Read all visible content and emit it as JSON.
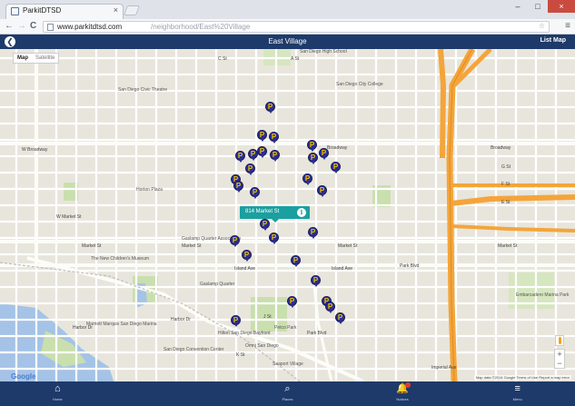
{
  "browser": {
    "tab_title": "ParkitDTSD",
    "tab_close": "×",
    "url_host": "www.parkitdtsd.com",
    "url_path": "/neighborhood/East%20Village",
    "back_glyph": "←",
    "forward_glyph": "→",
    "reload_glyph": "C",
    "omni_icons": "☆",
    "menu_glyph": "≡",
    "window_controls": [
      "–",
      "□",
      "×"
    ]
  },
  "header": {
    "title": "East Village",
    "back_glyph": "❮",
    "list_label": "List Map"
  },
  "map": {
    "type_options": [
      "Map",
      "Satellite"
    ],
    "callout_text": "814 Market St",
    "info_glyph": "i",
    "pin_glyph": "P",
    "google_text": "Google",
    "attribution": "Map data ©2014 Google   Terms of Use   Report a map error",
    "zoom_in": "+",
    "zoom_out": "−",
    "labels": [
      {
        "text": "Broadway",
        "kind": "road"
      },
      {
        "text": "Broadway",
        "kind": "road"
      },
      {
        "text": "Market St",
        "kind": "road"
      },
      {
        "text": "Market St",
        "kind": "road"
      },
      {
        "text": "Market St",
        "kind": "road"
      },
      {
        "text": "Market St",
        "kind": "road"
      },
      {
        "text": "Island Ave",
        "kind": "road"
      },
      {
        "text": "Island Ave",
        "kind": "road"
      },
      {
        "text": "J St",
        "kind": "road"
      },
      {
        "text": "K St",
        "kind": "road"
      },
      {
        "text": "G St",
        "kind": "road"
      },
      {
        "text": "F St",
        "kind": "road"
      },
      {
        "text": "E St",
        "kind": "road"
      },
      {
        "text": "C St",
        "kind": "road"
      },
      {
        "text": "A St",
        "kind": "road"
      },
      {
        "text": "W Broadway",
        "kind": "road"
      },
      {
        "text": "W Market St",
        "kind": "road"
      },
      {
        "text": "Park Blvd",
        "kind": "road"
      },
      {
        "text": "Harbor Dr",
        "kind": "road"
      },
      {
        "text": "Imperial Ave",
        "kind": "road"
      },
      {
        "text": "San Diego City College",
        "kind": "poi"
      },
      {
        "text": "San Diego High School",
        "kind": "poi"
      },
      {
        "text": "San Diego Civic Theatre",
        "kind": "poi"
      },
      {
        "text": "Horton Plaza",
        "kind": "poi"
      },
      {
        "text": "Petco Park",
        "kind": "poi"
      },
      {
        "text": "San Diego Convention Center",
        "kind": "poi"
      },
      {
        "text": "Marriott Marquis San Diego Marina",
        "kind": "poi"
      },
      {
        "text": "Hilton San Diego Bayfront",
        "kind": "poi"
      },
      {
        "text": "Omni San Diego",
        "kind": "poi"
      },
      {
        "text": "Embarcadero Marina Park",
        "kind": "poi"
      },
      {
        "text": "The New Children's Museum",
        "kind": "poi"
      },
      {
        "text": "Gaslamp Quarter Association",
        "kind": "poi"
      },
      {
        "text": "Seaport Village",
        "kind": "poi"
      },
      {
        "text": "Park Blvd",
        "kind": "road"
      },
      {
        "text": "Harbor Dr",
        "kind": "road"
      },
      {
        "text": "Gaslamp Quarter",
        "kind": "poi"
      }
    ],
    "pin_count": 29
  },
  "bottom_nav": [
    {
      "label": "Home",
      "icon": "⌂",
      "name": "home"
    },
    {
      "label": "",
      "icon": "",
      "name": "blank"
    },
    {
      "label": "Places",
      "icon": "⌕",
      "name": "search"
    },
    {
      "label": "Notices",
      "icon": "🔔",
      "name": "notices"
    },
    {
      "label": "Menu",
      "icon": "≡",
      "name": "menu"
    }
  ],
  "colors": {
    "header": "#1e3a6a",
    "pin": "#2b2f8f",
    "pin_letter": "#f2c200",
    "callout": "#1b9fa0",
    "freeway": "#f4a53a",
    "water": "#a4c3e6",
    "park": "#c9dfad"
  }
}
